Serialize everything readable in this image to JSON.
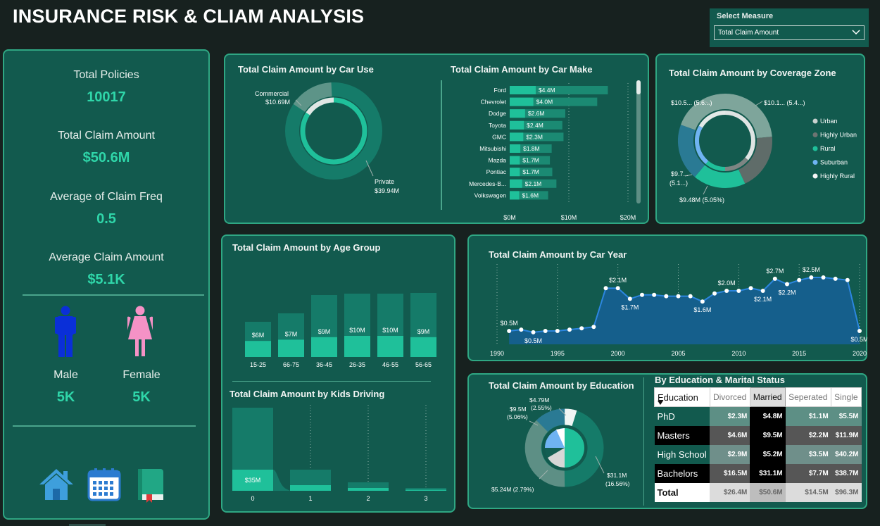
{
  "title": "INSURANCE RISK & CLIAM ANALYSIS",
  "measure": {
    "label": "Select Measure",
    "value": "Total Claim Amount"
  },
  "kpis": {
    "policies_label": "Total Policies",
    "policies_value": "10017",
    "claim_label": "Total Claim Amount",
    "claim_value": "$50.6M",
    "freq_label": "Average of Claim Freq",
    "freq_value": "0.5",
    "avg_label": "Average Claim Amount",
    "avg_value": "$5.1K",
    "male_label": "Male",
    "male_value": "5K",
    "female_label": "Female",
    "female_value": "5K"
  },
  "nav": {
    "home_icon": "home-icon",
    "calendar_icon": "calendar-icon",
    "book_icon": "book-icon"
  },
  "colors": {
    "teal": "#1fc09a",
    "dark_teal": "#157b69",
    "panel": "#125a4e",
    "blue": "#1f7bd0"
  },
  "chart_data": [
    {
      "type": "pie",
      "title": "Total Claim Amount by Car Use",
      "labels": [
        "Commercial",
        "Private"
      ],
      "values": [
        10.69,
        39.94
      ],
      "data_labels": [
        "$10.69M",
        "$39.94M"
      ]
    },
    {
      "type": "bar",
      "title": "Total Claim Amount by Car Make",
      "categories": [
        "Ford",
        "Chevrolet",
        "Dodge",
        "Toyota",
        "GMC",
        "Mitsubishi",
        "Mazda",
        "Pontiac",
        "Mercedes-B...",
        "Volkswagen"
      ],
      "values": [
        4.4,
        4.0,
        2.6,
        2.4,
        2.3,
        1.8,
        1.7,
        1.7,
        2.1,
        1.6
      ],
      "totals": [
        16.6,
        14.8,
        9.4,
        8.9,
        9.1,
        7.1,
        6.8,
        7.2,
        7.9,
        6.5
      ],
      "data_labels": [
        "$4.4M",
        "$4.0M",
        "$2.6M",
        "$2.4M",
        "$2.3M",
        "$1.8M",
        "$1.7M",
        "$1.7M",
        "$2.1M",
        "$1.6M"
      ],
      "xticks": [
        "$0M",
        "$10M",
        "$20M"
      ],
      "xlim": [
        0,
        20
      ]
    },
    {
      "type": "pie",
      "title": "Total Claim Amount by Coverage Zone",
      "labels": [
        "Urban",
        "Highly Urban",
        "Rural",
        "Suburban",
        "Highly Rural"
      ],
      "colors": [
        "#c9d1cf",
        "#6d7472",
        "#1fc09a",
        "#6fb3f2",
        "#f4f4f4"
      ],
      "data_labels": [
        "$10.5... (5.6...)",
        "$10.1... (5.4...)",
        "$9.7... (5.1...)",
        "$9.48M (5.05%)"
      ]
    },
    {
      "type": "bar",
      "title": "Total Claim Amount by Age Group",
      "categories": [
        "15-25",
        "66-75",
        "36-45",
        "26-35",
        "46-55",
        "56-65"
      ],
      "values": [
        6,
        7,
        9,
        10,
        10,
        9
      ],
      "data_labels": [
        "$6M",
        "$7M",
        "$9M",
        "$10M",
        "$10M",
        "$9M"
      ]
    },
    {
      "type": "bar",
      "title": "Total Claim Amount by Kids Driving",
      "categories": [
        "0",
        "1",
        "2",
        "3"
      ],
      "values": [
        35,
        8,
        4,
        1
      ],
      "data_labels": [
        "$35M",
        "",
        "",
        ""
      ]
    },
    {
      "type": "area",
      "title": "Total Claim Amount by Car Year",
      "x": [
        1991,
        1992,
        1993,
        1994,
        1995,
        1996,
        1997,
        1998,
        1999,
        2000,
        2001,
        2002,
        2003,
        2004,
        2005,
        2006,
        2007,
        2008,
        2009,
        2010,
        2011,
        2012,
        2013,
        2014,
        2015,
        2016,
        2017,
        2018,
        2019,
        2020
      ],
      "y": [
        0.5,
        0.55,
        0.45,
        0.5,
        0.5,
        0.55,
        0.6,
        0.65,
        2.1,
        2.1,
        1.7,
        1.85,
        1.85,
        1.8,
        1.8,
        1.8,
        1.6,
        1.9,
        2.0,
        2.0,
        2.1,
        2.0,
        2.45,
        2.25,
        2.4,
        2.5,
        2.5,
        2.45,
        2.4,
        0.5
      ],
      "point_labels": [
        {
          "x": 1991,
          "text": "$0.5M",
          "pos": "above"
        },
        {
          "x": 1993,
          "text": "$0.5M",
          "pos": "below"
        },
        {
          "x": 2000,
          "text": "$2.1M",
          "pos": "above"
        },
        {
          "x": 2001,
          "text": "$1.7M",
          "pos": "below"
        },
        {
          "x": 2007,
          "text": "$1.6M",
          "pos": "below"
        },
        {
          "x": 2009,
          "text": "$2.0M",
          "pos": "above"
        },
        {
          "x": 2012,
          "text": "$2.1M",
          "pos": "below"
        },
        {
          "x": 2013,
          "text": "$2.7M",
          "pos": "above"
        },
        {
          "x": 2014,
          "text": "$2.2M",
          "pos": "below"
        },
        {
          "x": 2016,
          "text": "$2.5M",
          "pos": "above"
        },
        {
          "x": 2020,
          "text": "$0.5M",
          "pos": "below"
        }
      ],
      "xticks": [
        1990,
        1995,
        2000,
        2005,
        2010,
        2015,
        2020
      ],
      "ylim": [
        0,
        3
      ]
    },
    {
      "type": "pie",
      "title": "Total Claim Amount by Education",
      "data_labels": [
        "$4.79M (2.55%)",
        "$9.5M (5.06%)",
        "$5.24M (2.79%)",
        "$31.1M (16.56%)"
      ]
    },
    {
      "type": "table",
      "title": "By Education & Marital Status",
      "columns": [
        "Education",
        "Divorced",
        "Married",
        "Seperated",
        "Single"
      ],
      "rows": [
        {
          "label": "PhD",
          "values": [
            "$2.3M",
            "$4.8M",
            "$1.1M",
            "$5.5M"
          ]
        },
        {
          "label": "Masters",
          "values": [
            "$4.6M",
            "$9.5M",
            "$2.2M",
            "$11.9M"
          ]
        },
        {
          "label": "High School",
          "values": [
            "$2.9M",
            "$5.2M",
            "$3.5M",
            "$40.2M"
          ]
        },
        {
          "label": "Bachelors",
          "values": [
            "$16.5M",
            "$31.1M",
            "$7.7M",
            "$38.7M"
          ]
        }
      ],
      "total": {
        "label": "Total",
        "values": [
          "$26.4M",
          "$50.6M",
          "$14.5M",
          "$96.3M"
        ]
      }
    }
  ]
}
